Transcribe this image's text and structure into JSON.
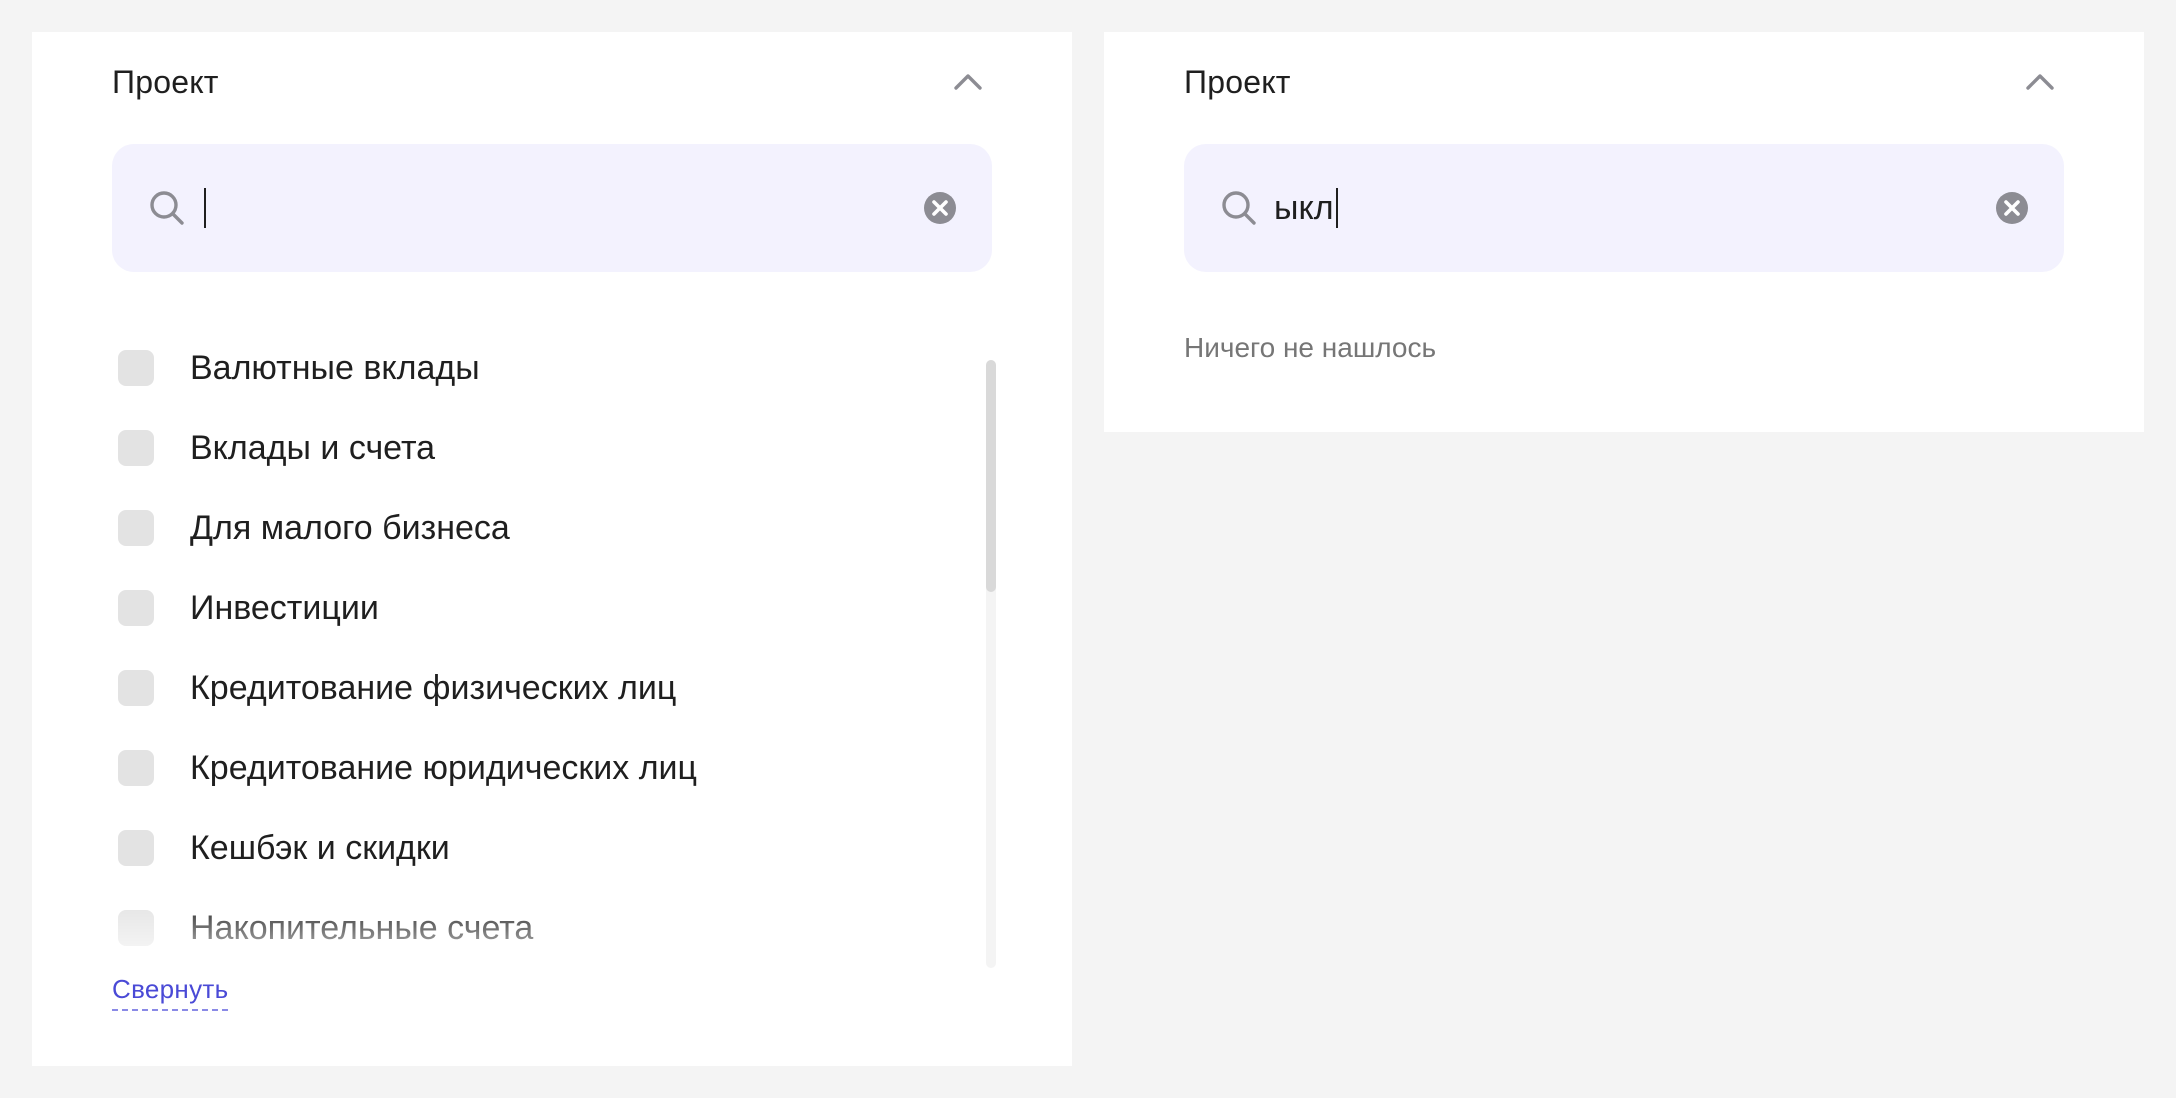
{
  "left_panel": {
    "title": "Проект",
    "search": {
      "value": "",
      "placeholder": ""
    },
    "items": [
      {
        "label": "Валютные вклады",
        "checked": false
      },
      {
        "label": "Вклады и счета",
        "checked": false
      },
      {
        "label": "Для малого бизнеса",
        "checked": false
      },
      {
        "label": "Инвестиции",
        "checked": false
      },
      {
        "label": "Кредитование физических лиц",
        "checked": false
      },
      {
        "label": "Кредитование юридических лиц",
        "checked": false
      },
      {
        "label": "Кешбэк и скидки",
        "checked": false
      },
      {
        "label": "Накопительные счета",
        "checked": false
      }
    ],
    "collapse_label": "Свернуть"
  },
  "right_panel": {
    "title": "Проект",
    "search": {
      "value": "ыкл"
    },
    "empty_message": "Ничего не нашлось"
  },
  "colors": {
    "page_bg": "#f4f4f4",
    "panel_bg": "#ffffff",
    "search_bg": "#f3f2fe",
    "checkbox_bg": "#e3e3e3",
    "link": "#4a4ad6",
    "icon": "#8c8c93"
  },
  "icons": {
    "collapse": "chevron-up-icon",
    "search": "search-icon",
    "clear": "clear-circle-x-icon"
  }
}
